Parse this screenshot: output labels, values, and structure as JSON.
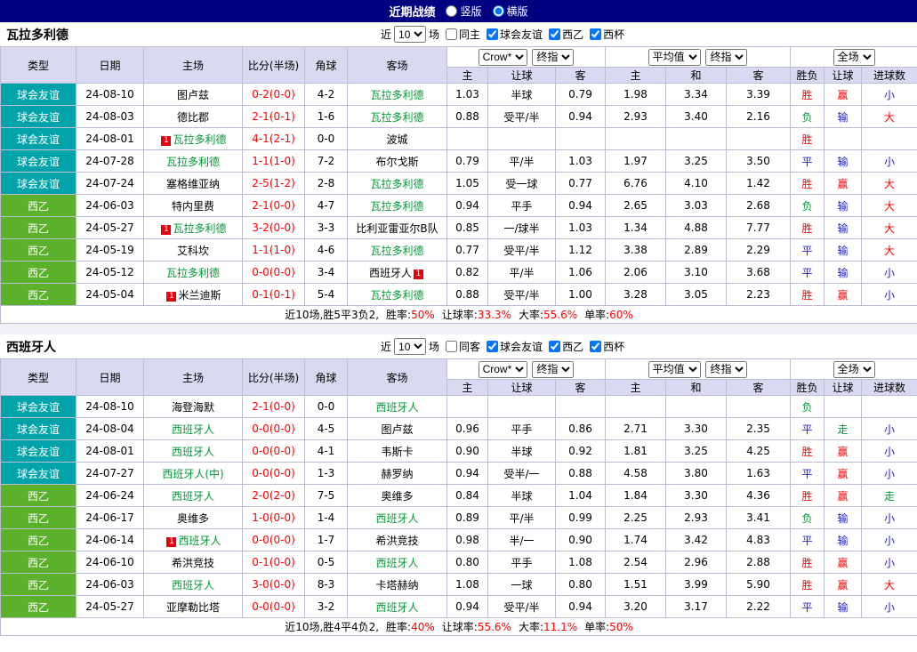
{
  "topbar": {
    "title": "近期战绩",
    "options": [
      {
        "label": "竖版",
        "selected": false
      },
      {
        "label": "横版",
        "selected": true
      }
    ]
  },
  "filter": {
    "prefix": "近",
    "count": "10",
    "suffix": "场"
  },
  "header": {
    "type": "类型",
    "date": "日期",
    "home": "主场",
    "score": "比分(半场)",
    "corner": "角球",
    "away": "客场",
    "odds_home": "主",
    "odds_handicap": "让球",
    "odds_away": "客",
    "euro_home": "主",
    "euro_draw": "和",
    "euro_away": "客",
    "res_wdl": "胜负",
    "res_handicap": "让球",
    "res_goals": "进球数",
    "select_crow": "Crow*",
    "select_final": "终指",
    "select_avg": "平均值",
    "select_final2": "终指",
    "select_fulltime": "全场"
  },
  "colors": {
    "topbar_bg": "#000080",
    "header_bg": "#d9d9f1",
    "friendly_bg": "#00a3aa",
    "league_bg": "#5cb12c",
    "focal_team": "#009933",
    "score": "#ff0000"
  },
  "result_colors": {
    "胜": "#ff0000",
    "赢": "#ff0000",
    "大": "#ff0000",
    "平": "#2222cc",
    "输": "#2222cc",
    "小": "#2222cc",
    "负": "#009933",
    "走": "#009933"
  },
  "sections": [
    {
      "team": "瓦拉多利德",
      "filters": [
        {
          "label": "同主",
          "checked": false
        },
        {
          "label": "球会友谊",
          "checked": true
        },
        {
          "label": "西乙",
          "checked": true
        },
        {
          "label": "西杯",
          "checked": true
        }
      ],
      "rows": [
        {
          "type": "球会友谊",
          "league": "friendly",
          "date": "24-08-10",
          "home": "图卢兹",
          "home_focal": false,
          "home_badge": "",
          "score": "0-2(0-0)",
          "corner": "4-2",
          "away": "瓦拉多利德",
          "away_focal": true,
          "away_badge": "",
          "odds": [
            "1.03",
            "半球",
            "0.79",
            "1.98",
            "3.34",
            "3.39"
          ],
          "results": [
            "胜",
            "赢",
            "小"
          ]
        },
        {
          "type": "球会友谊",
          "league": "friendly",
          "date": "24-08-03",
          "home": "德比郡",
          "home_focal": false,
          "home_badge": "",
          "score": "2-1(0-1)",
          "corner": "1-6",
          "away": "瓦拉多利德",
          "away_focal": true,
          "away_badge": "",
          "odds": [
            "0.88",
            "受平/半",
            "0.94",
            "2.93",
            "3.40",
            "2.16"
          ],
          "results": [
            "负",
            "输",
            "大"
          ]
        },
        {
          "type": "球会友谊",
          "league": "friendly",
          "date": "24-08-01",
          "home": "瓦拉多利德",
          "home_focal": true,
          "home_badge": "1",
          "score": "4-1(2-1)",
          "corner": "0-0",
          "away": "波城",
          "away_focal": false,
          "away_badge": "",
          "odds": [
            "",
            "",
            "",
            "",
            "",
            ""
          ],
          "results": [
            "胜",
            "",
            ""
          ]
        },
        {
          "type": "球会友谊",
          "league": "friendly",
          "date": "24-07-28",
          "home": "瓦拉多利德",
          "home_focal": true,
          "home_badge": "",
          "score": "1-1(1-0)",
          "corner": "7-2",
          "away": "布尔戈斯",
          "away_focal": false,
          "away_badge": "",
          "odds": [
            "0.79",
            "平/半",
            "1.03",
            "1.97",
            "3.25",
            "3.50"
          ],
          "results": [
            "平",
            "输",
            "小"
          ]
        },
        {
          "type": "球会友谊",
          "league": "friendly",
          "date": "24-07-24",
          "home": "塞格维亚纳",
          "home_focal": false,
          "home_badge": "",
          "score": "2-5(1-2)",
          "corner": "2-8",
          "away": "瓦拉多利德",
          "away_focal": true,
          "away_badge": "",
          "odds": [
            "1.05",
            "受一球",
            "0.77",
            "6.76",
            "4.10",
            "1.42"
          ],
          "results": [
            "胜",
            "赢",
            "大"
          ]
        },
        {
          "type": "西乙",
          "league": "league",
          "date": "24-06-03",
          "home": "特内里费",
          "home_focal": false,
          "home_badge": "",
          "score": "2-1(0-0)",
          "corner": "4-7",
          "away": "瓦拉多利德",
          "away_focal": true,
          "away_badge": "",
          "odds": [
            "0.94",
            "平手",
            "0.94",
            "2.65",
            "3.03",
            "2.68"
          ],
          "results": [
            "负",
            "输",
            "大"
          ]
        },
        {
          "type": "西乙",
          "league": "league",
          "date": "24-05-27",
          "home": "瓦拉多利德",
          "home_focal": true,
          "home_badge": "1",
          "score": "3-2(0-0)",
          "corner": "3-3",
          "away": "比利亚雷亚尔B队",
          "away_focal": false,
          "away_badge": "",
          "odds": [
            "0.85",
            "一/球半",
            "1.03",
            "1.34",
            "4.88",
            "7.77"
          ],
          "results": [
            "胜",
            "输",
            "大"
          ]
        },
        {
          "type": "西乙",
          "league": "league",
          "date": "24-05-19",
          "home": "艾科坎",
          "home_focal": false,
          "home_badge": "",
          "score": "1-1(1-0)",
          "corner": "4-6",
          "away": "瓦拉多利德",
          "away_focal": true,
          "away_badge": "",
          "odds": [
            "0.77",
            "受平/半",
            "1.12",
            "3.38",
            "2.89",
            "2.29"
          ],
          "results": [
            "平",
            "输",
            "大"
          ]
        },
        {
          "type": "西乙",
          "league": "league",
          "date": "24-05-12",
          "home": "瓦拉多利德",
          "home_focal": true,
          "home_badge": "",
          "score": "0-0(0-0)",
          "corner": "3-4",
          "away": "西班牙人",
          "away_focal": false,
          "away_badge": "1",
          "odds": [
            "0.82",
            "平/半",
            "1.06",
            "2.06",
            "3.10",
            "3.68"
          ],
          "results": [
            "平",
            "输",
            "小"
          ]
        },
        {
          "type": "西乙",
          "league": "league",
          "date": "24-05-04",
          "home": "米兰迪斯",
          "home_focal": false,
          "home_badge": "1",
          "score": "0-1(0-1)",
          "corner": "5-4",
          "away": "瓦拉多利德",
          "away_focal": true,
          "away_badge": "",
          "odds": [
            "0.88",
            "受平/半",
            "1.00",
            "3.28",
            "3.05",
            "2.23"
          ],
          "results": [
            "胜",
            "赢",
            "小"
          ]
        }
      ],
      "summary": {
        "prefix": "近10场,胜5平3负2,",
        "stats": [
          {
            "label": "胜率:",
            "value": "50%"
          },
          {
            "label": "让球率:",
            "value": "33.3%"
          },
          {
            "label": "大率:",
            "value": "55.6%"
          },
          {
            "label": "单率:",
            "value": "60%"
          }
        ]
      }
    },
    {
      "team": "西班牙人",
      "filters": [
        {
          "label": "同客",
          "checked": false
        },
        {
          "label": "球会友谊",
          "checked": true
        },
        {
          "label": "西乙",
          "checked": true
        },
        {
          "label": "西杯",
          "checked": true
        }
      ],
      "rows": [
        {
          "type": "球会友谊",
          "league": "friendly",
          "date": "24-08-10",
          "home": "海登海默",
          "home_focal": false,
          "home_badge": "",
          "score": "2-1(0-0)",
          "corner": "0-0",
          "away": "西班牙人",
          "away_focal": true,
          "away_badge": "",
          "odds": [
            "",
            "",
            "",
            "",
            "",
            ""
          ],
          "results": [
            "负",
            "",
            ""
          ]
        },
        {
          "type": "球会友谊",
          "league": "friendly",
          "date": "24-08-04",
          "home": "西班牙人",
          "home_focal": true,
          "home_badge": "",
          "score": "0-0(0-0)",
          "corner": "4-5",
          "away": "图卢兹",
          "away_focal": false,
          "away_badge": "",
          "odds": [
            "0.96",
            "平手",
            "0.86",
            "2.71",
            "3.30",
            "2.35"
          ],
          "results": [
            "平",
            "走",
            "小"
          ]
        },
        {
          "type": "球会友谊",
          "league": "friendly",
          "date": "24-08-01",
          "home": "西班牙人",
          "home_focal": true,
          "home_badge": "",
          "score": "0-0(0-0)",
          "corner": "4-1",
          "away": "韦斯卡",
          "away_focal": false,
          "away_badge": "",
          "odds": [
            "0.90",
            "半球",
            "0.92",
            "1.81",
            "3.25",
            "4.25"
          ],
          "results": [
            "胜",
            "赢",
            "小"
          ]
        },
        {
          "type": "球会友谊",
          "league": "friendly",
          "date": "24-07-27",
          "home": "西班牙人(中)",
          "home_focal": true,
          "home_badge": "",
          "score": "0-0(0-0)",
          "corner": "1-3",
          "away": "赫罗纳",
          "away_focal": false,
          "away_badge": "",
          "odds": [
            "0.94",
            "受半/一",
            "0.88",
            "4.58",
            "3.80",
            "1.63"
          ],
          "results": [
            "平",
            "赢",
            "小"
          ]
        },
        {
          "type": "西乙",
          "league": "league",
          "date": "24-06-24",
          "home": "西班牙人",
          "home_focal": true,
          "home_badge": "",
          "score": "2-0(2-0)",
          "corner": "7-5",
          "away": "奥维多",
          "away_focal": false,
          "away_badge": "",
          "odds": [
            "0.84",
            "半球",
            "1.04",
            "1.84",
            "3.30",
            "4.36"
          ],
          "results": [
            "胜",
            "赢",
            "走"
          ]
        },
        {
          "type": "西乙",
          "league": "league",
          "date": "24-06-17",
          "home": "奥维多",
          "home_focal": false,
          "home_badge": "",
          "score": "1-0(0-0)",
          "corner": "1-4",
          "away": "西班牙人",
          "away_focal": true,
          "away_badge": "",
          "odds": [
            "0.89",
            "平/半",
            "0.99",
            "2.25",
            "2.93",
            "3.41"
          ],
          "results": [
            "负",
            "输",
            "小"
          ]
        },
        {
          "type": "西乙",
          "league": "league",
          "date": "24-06-14",
          "home": "西班牙人",
          "home_focal": true,
          "home_badge": "1",
          "score": "0-0(0-0)",
          "corner": "1-7",
          "away": "希洪竞技",
          "away_focal": false,
          "away_badge": "",
          "odds": [
            "0.98",
            "半/一",
            "0.90",
            "1.74",
            "3.42",
            "4.83"
          ],
          "results": [
            "平",
            "输",
            "小"
          ]
        },
        {
          "type": "西乙",
          "league": "league",
          "date": "24-06-10",
          "home": "希洪竞技",
          "home_focal": false,
          "home_badge": "",
          "score": "0-1(0-0)",
          "corner": "0-5",
          "away": "西班牙人",
          "away_focal": true,
          "away_badge": "",
          "odds": [
            "0.80",
            "平手",
            "1.08",
            "2.54",
            "2.96",
            "2.88"
          ],
          "results": [
            "胜",
            "赢",
            "小"
          ]
        },
        {
          "type": "西乙",
          "league": "league",
          "date": "24-06-03",
          "home": "西班牙人",
          "home_focal": true,
          "home_badge": "",
          "score": "3-0(0-0)",
          "corner": "8-3",
          "away": "卡塔赫纳",
          "away_focal": false,
          "away_badge": "",
          "odds": [
            "1.08",
            "一球",
            "0.80",
            "1.51",
            "3.99",
            "5.90"
          ],
          "results": [
            "胜",
            "赢",
            "大"
          ]
        },
        {
          "type": "西乙",
          "league": "league",
          "date": "24-05-27",
          "home": "亚摩勒比塔",
          "home_focal": false,
          "home_badge": "",
          "score": "0-0(0-0)",
          "corner": "3-2",
          "away": "西班牙人",
          "away_focal": true,
          "away_badge": "",
          "odds": [
            "0.94",
            "受平/半",
            "0.94",
            "3.20",
            "3.17",
            "2.22"
          ],
          "results": [
            "平",
            "输",
            "小"
          ]
        }
      ],
      "summary": {
        "prefix": "近10场,胜4平4负2,",
        "stats": [
          {
            "label": "胜率:",
            "value": "40%"
          },
          {
            "label": "让球率:",
            "value": "55.6%"
          },
          {
            "label": "大率:",
            "value": "11.1%"
          },
          {
            "label": "单率:",
            "value": "50%"
          }
        ]
      }
    }
  ]
}
